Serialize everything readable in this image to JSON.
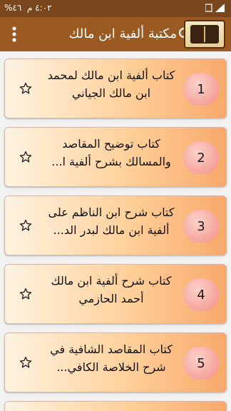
{
  "status_bar": {
    "time": "٤:٠٢ م",
    "battery": "٤٦%"
  },
  "app_bar": {
    "title": "مكتبة ألفية ابن مالك",
    "logo": "book-logo"
  },
  "books": [
    {
      "number": "1",
      "title": "كتاب ألفية ابن مالك لمحمد ابن مالك الجياني"
    },
    {
      "number": "2",
      "title": "كتاب توضيح المقاصد والمسالك بشرح ألفية ا..."
    },
    {
      "number": "3",
      "title": "كتاب شرح ابن الناظم على ألفية ابن مالك لبدر الد..."
    },
    {
      "number": "4",
      "title": "كتاب شرح ألفية ابن مالك أحمد الحازمي"
    },
    {
      "number": "5",
      "title": "كتاب المقاصد الشافية في شرح الخلاصة الكافي..."
    }
  ],
  "colors": {
    "status_bar": "#7a461d",
    "app_bar": "#9a5a22",
    "badge": "#f08e86",
    "card_accent": "#f7a96b"
  }
}
